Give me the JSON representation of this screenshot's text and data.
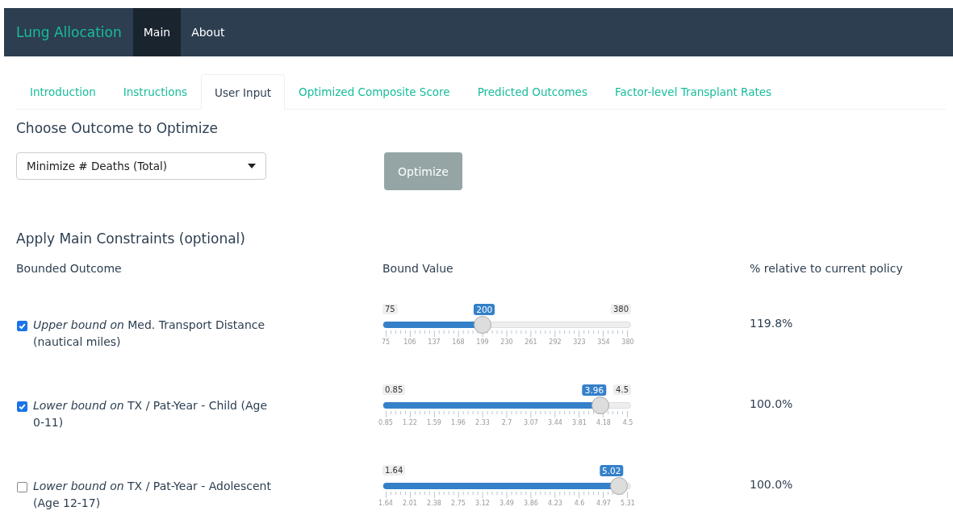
{
  "navbar": {
    "brand": "Lung Allocation",
    "items": [
      {
        "label": "Main",
        "selected": true
      },
      {
        "label": "About",
        "selected": false
      }
    ]
  },
  "tabs": [
    {
      "label": "Introduction",
      "selected": false
    },
    {
      "label": "Instructions",
      "selected": false
    },
    {
      "label": "User Input",
      "selected": true
    },
    {
      "label": "Optimized Composite Score",
      "selected": false
    },
    {
      "label": "Predicted Outcomes",
      "selected": false
    },
    {
      "label": "Factor-level Transplant Rates",
      "selected": false
    }
  ],
  "optimize_section": {
    "title": "Choose Outcome to Optimize",
    "select": {
      "value": "Minimize # Deaths (Total)"
    },
    "button": {
      "label": "Optimize",
      "disabled": true
    }
  },
  "constraints": {
    "title": "Apply Main Constraints (optional)",
    "columns": [
      "Bounded Outcome",
      "Bound Value",
      "% relative to current policy"
    ],
    "rows": [
      {
        "checked": true,
        "label": "*Upper bound on* Med. Transport Distance (nautical miles)",
        "slider": {
          "min_label": "75",
          "max_label": "380",
          "value": "200",
          "level": 0.41,
          "ticks": [
            "75",
            "106",
            "137",
            "168",
            "199",
            "230",
            "261",
            "292",
            "323",
            "354",
            "380"
          ]
        },
        "relative": "119.8%"
      },
      {
        "checked": true,
        "label": "*Lower bound on* TX / Pat-Year - Child (Age 0-11)",
        "slider": {
          "min_label": "0.85",
          "max_label": "4.5",
          "value": "3.96",
          "level": 0.852,
          "ticks": [
            "0.85",
            "1.22",
            "1.59",
            "1.96",
            "2.33",
            "2.7",
            "3.07",
            "3.44",
            "3.81",
            "4.18",
            "4.5"
          ]
        },
        "relative": "100.0%"
      },
      {
        "checked": false,
        "label": "*Lower bound on* TX / Pat-Year - Adolescent (Age 12-17)",
        "slider": {
          "min_label": "1.64",
          "value": "5.02",
          "level": 0.921,
          "ticks": [
            "1.64",
            "2.01",
            "2.38",
            "2.75",
            "3.12",
            "3.49",
            "3.86",
            "4.23",
            "4.6",
            "4.97",
            "5.31"
          ]
        },
        "relative": "100.0%"
      }
    ]
  }
}
